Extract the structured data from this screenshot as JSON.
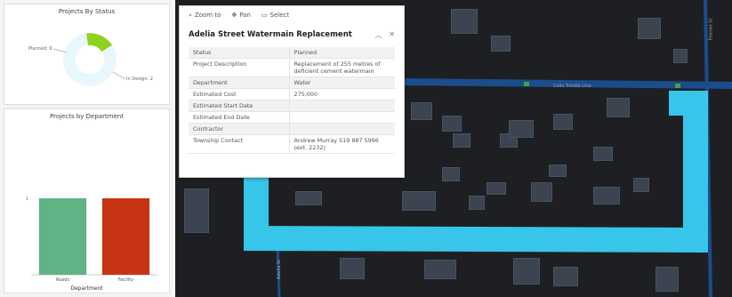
{
  "dashboard": {
    "status_chart": {
      "title": "Projects By Status",
      "slices": [
        {
          "label": "Planned: 9",
          "value": 9,
          "color": "#e8f7fb"
        },
        {
          "label": "In Design: 2",
          "value": 2,
          "color": "#8ed21e"
        }
      ]
    },
    "department_chart": {
      "title": "Projects by Department",
      "y_tick": "1"
    }
  },
  "chart_data": {
    "type": "bar",
    "title": "Projects by Department",
    "categories": [
      "Roads",
      "Facility"
    ],
    "values": [
      1,
      1
    ],
    "colors": [
      "#5fb385",
      "#c73415"
    ],
    "xlabel": "Department",
    "ylabel": "",
    "ylim": [
      0,
      1
    ]
  },
  "popup": {
    "toolbar": {
      "zoom": "Zoom to",
      "pan": "Pan",
      "select": "Select"
    },
    "title": "Adelia Street Watermain Replacement",
    "rows": [
      {
        "key": "Status",
        "value": "Planned"
      },
      {
        "key": "Project Description",
        "value": "Replacement of 255 metres of deficient cement watermain"
      },
      {
        "key": "Department",
        "value": "Water"
      },
      {
        "key": "Estimated Cost",
        "value": "275,000"
      },
      {
        "key": "Estimated Start Date",
        "value": ""
      },
      {
        "key": "Estimated End Date",
        "value": ""
      },
      {
        "key": "Contractor",
        "value": ""
      },
      {
        "key": "Township Contact",
        "value": "Andrew Murray 519 887 5996 (ext. 2232)"
      }
    ]
  },
  "map": {
    "roads": {
      "top_right": "Colin Trindle Line",
      "right_vertical": "Feenan St",
      "bottom": "Adelia St"
    },
    "colors": {
      "highlight": "#39d0f4",
      "background": "#1e1f22"
    }
  }
}
